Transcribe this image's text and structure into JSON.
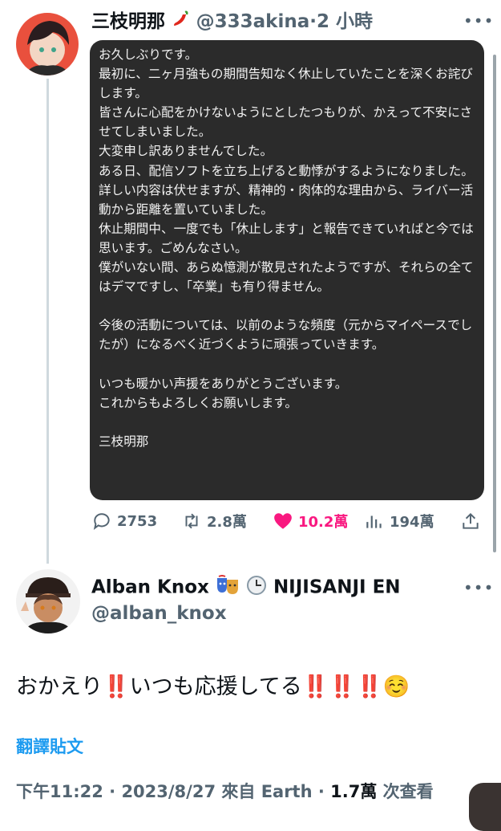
{
  "tweet": {
    "author_name": "三枝明那",
    "handle_time": "@333akina·2 小時",
    "more_icon": "more-dots-icon",
    "note_text": "お久しぶりです。\n最初に、二ヶ月強もの期間告知なく休止していたことを深くお詫びします。\n皆さんに心配をかけないようにとしたつもりが、かえって不安にさせてしまいました。\n大変申し訳ありませんでした。\nある日、配信ソフトを立ち上げると動悸がするようになりました。\n詳しい内容は伏せますが、精神的・肉体的な理由から、ライバー活動から距離を置いていました。\n休止期間中、一度でも「休止します」と報告できていればと今では思います。ごめんなさい。\n僕がいない間、あらぬ憶測が散見されたようですが、それらの全てはデマですし、「卒業」も有り得ません。\n\n今後の活動については、以前のような頻度（元からマイペースでしたが）になるべく近づくように頑張っていきます。\n\nいつも暖かい声援をありがとうございます。\nこれからもよろしくお願いします。\n\n三枝明那",
    "stats": {
      "replies": "2753",
      "retweets": "2.8萬",
      "likes": "10.2萬",
      "views": "194萬"
    },
    "like_color": "#f91880"
  },
  "reply": {
    "author_name": "Alban Knox",
    "affiliation": "NIJISANJI EN",
    "handle": "@alban_knox",
    "text": "おかえり‼️いつも応援してる‼️‼️‼️☺️",
    "translate_label": "翻譯貼文",
    "meta_time": "下午11:22 · 2023/8/27 來自 Earth · ",
    "meta_views": "1.7萬",
    "meta_views_suffix": " 次查看"
  },
  "colors": {
    "accent": "#1d9bf0",
    "secondary_text": "#536471",
    "note_background": "#2b2b2b"
  }
}
